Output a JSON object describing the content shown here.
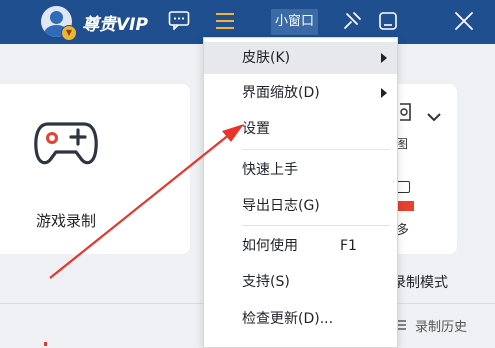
{
  "titlebar": {
    "vip_label": "尊贵VIP",
    "mini_window_label": "小窗口"
  },
  "icons": {
    "avatar": "avatar-icon",
    "message": "message-icon",
    "menu": "hamburger-menu-icon",
    "pin": "pin-icon",
    "minimize": "minimize-icon",
    "close": "close-icon"
  },
  "main": {
    "game_card_label": "游戏录制",
    "partial_text_tu": "图",
    "partial_text_duo": "多",
    "mode_label": "录制模式",
    "history_label": "录制历史"
  },
  "menu": {
    "items": [
      {
        "label": "皮肤(K)",
        "submenu": true
      },
      {
        "label": "界面缩放(D)",
        "submenu": true
      },
      {
        "label": "设置"
      },
      {
        "label": "快速上手"
      },
      {
        "label": "导出日志(G)"
      },
      {
        "label": "如何使用",
        "shortcut": "F1"
      },
      {
        "label": "支持(S)"
      },
      {
        "label": "检查更新(D)..."
      }
    ]
  },
  "colors": {
    "titlebar": "#1f4f8f",
    "annotation_arrow": "#e8342b",
    "accent_red": "#e8412f"
  }
}
